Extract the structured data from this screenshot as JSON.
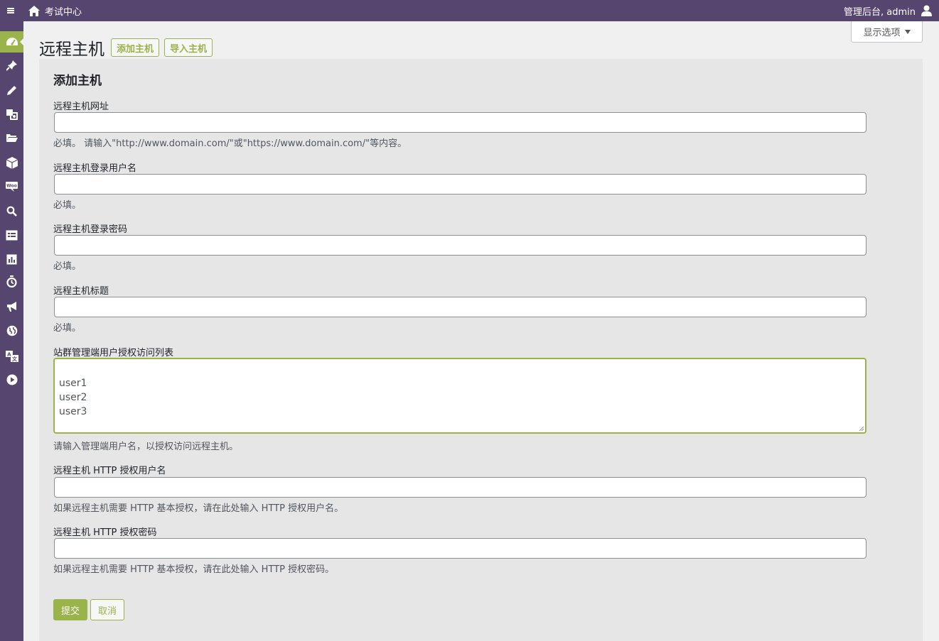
{
  "adminbar": {
    "site_name": "考试中心",
    "account_label": "管理后台, admin",
    "menu_icon": "hamburger-icon",
    "home_icon": "home-icon",
    "user_icon": "user-icon"
  },
  "sidebar": {
    "items": [
      {
        "icon": "dashboard-icon",
        "active": true
      },
      {
        "icon": "pin-icon"
      },
      {
        "icon": "pencil-icon"
      },
      {
        "icon": "media-icon"
      },
      {
        "icon": "folder-icon"
      },
      {
        "icon": "box-icon"
      },
      {
        "icon": "woo-icon"
      },
      {
        "icon": "search-icon"
      },
      {
        "icon": "form-icon"
      },
      {
        "icon": "chart-icon"
      },
      {
        "icon": "clock-icon"
      },
      {
        "icon": "megaphone-icon"
      },
      {
        "icon": "globe-icon"
      },
      {
        "icon": "translate-icon"
      },
      {
        "icon": "play-icon"
      }
    ]
  },
  "screen_options": {
    "label": "显示选项"
  },
  "page": {
    "title": "远程主机",
    "add_button": "添加主机",
    "import_button": "导入主机"
  },
  "form": {
    "heading": "添加主机",
    "fields": [
      {
        "label": "远程主机网址",
        "value": "",
        "description": "必填。 请输入\"http://www.domain.com/\"或\"https://www.domain.com/\"等内容。"
      },
      {
        "label": "远程主机登录用户名",
        "value": "",
        "description": "必填。"
      },
      {
        "label": "远程主机登录密码",
        "value": "",
        "description": "必填。"
      },
      {
        "label": "远程主机标题",
        "value": "",
        "description": "必填。"
      },
      {
        "label": "站群管理端用户授权访问列表",
        "value": "user1\nuser2\nuser3",
        "description": "请输入管理端用户名，以授权访问远程主机。"
      },
      {
        "label": "远程主机 HTTP 授权用户名",
        "value": "",
        "description": "如果远程主机需要 HTTP 基本授权，请在此处输入 HTTP 授权用户名。"
      },
      {
        "label": "远程主机 HTTP 授权密码",
        "value": "",
        "description": "如果远程主机需要 HTTP 基本授权，请在此处输入 HTTP 授权密码。"
      }
    ],
    "submit_label": "提交",
    "cancel_label": "取消"
  },
  "colors": {
    "adminbar": "#55456f",
    "accent": "#9ab34a"
  }
}
